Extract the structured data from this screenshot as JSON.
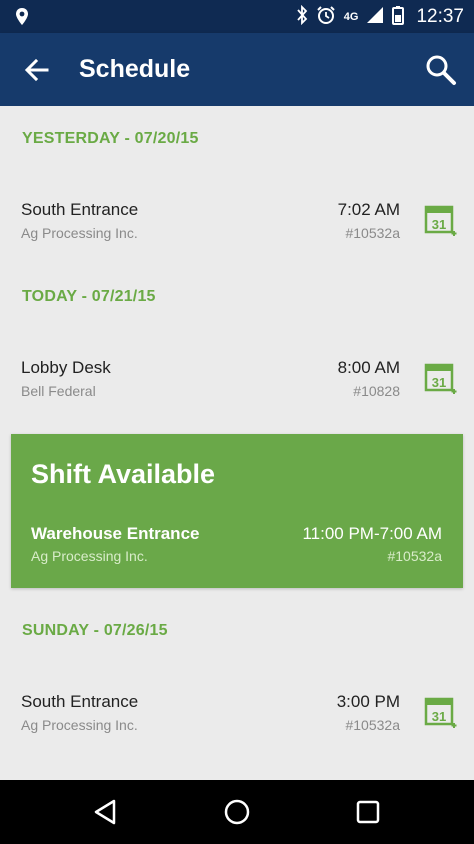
{
  "status_bar": {
    "network_label": "4G",
    "time": "12:37"
  },
  "app_bar": {
    "title": "Schedule"
  },
  "sections": [
    {
      "header": "YESTERDAY - 07/20/15",
      "shifts": [
        {
          "place": "South Entrance",
          "company": "Ag Processing Inc.",
          "time": "7:02 AM",
          "job": "#10532a",
          "calendar_day": "31"
        }
      ]
    },
    {
      "header": "TODAY - 07/21/15",
      "shifts": [
        {
          "place": "Lobby Desk",
          "company": "Bell Federal",
          "time": "8:00 AM",
          "job": "#10828",
          "calendar_day": "31"
        }
      ]
    },
    {
      "header": "SUNDAY - 07/26/15",
      "shifts": [
        {
          "place": "South Entrance",
          "company": "Ag Processing Inc.",
          "time": "3:00 PM",
          "job": "#10532a",
          "calendar_day": "31"
        }
      ]
    }
  ],
  "available_shift": {
    "heading": "Shift Available",
    "place": "Warehouse Entrance",
    "company": "Ag Processing Inc.",
    "time": "11:00 PM-7:00 AM",
    "job": "#10532a"
  },
  "colors": {
    "status_bar": "#0f2a52",
    "app_bar": "#163a6b",
    "accent_green": "#6aaa45",
    "card_green": "#6aa849",
    "background": "#ebebeb"
  },
  "icons": {
    "status_left": "location-pin-icon",
    "status_right": [
      "bluetooth-icon",
      "alarm-icon",
      "signal-icon",
      "battery-icon"
    ],
    "app_bar": [
      "back-arrow-icon",
      "search-icon"
    ],
    "row": "calendar-add-icon",
    "nav": [
      "back-triangle-icon",
      "home-circle-icon",
      "recents-square-icon"
    ]
  }
}
